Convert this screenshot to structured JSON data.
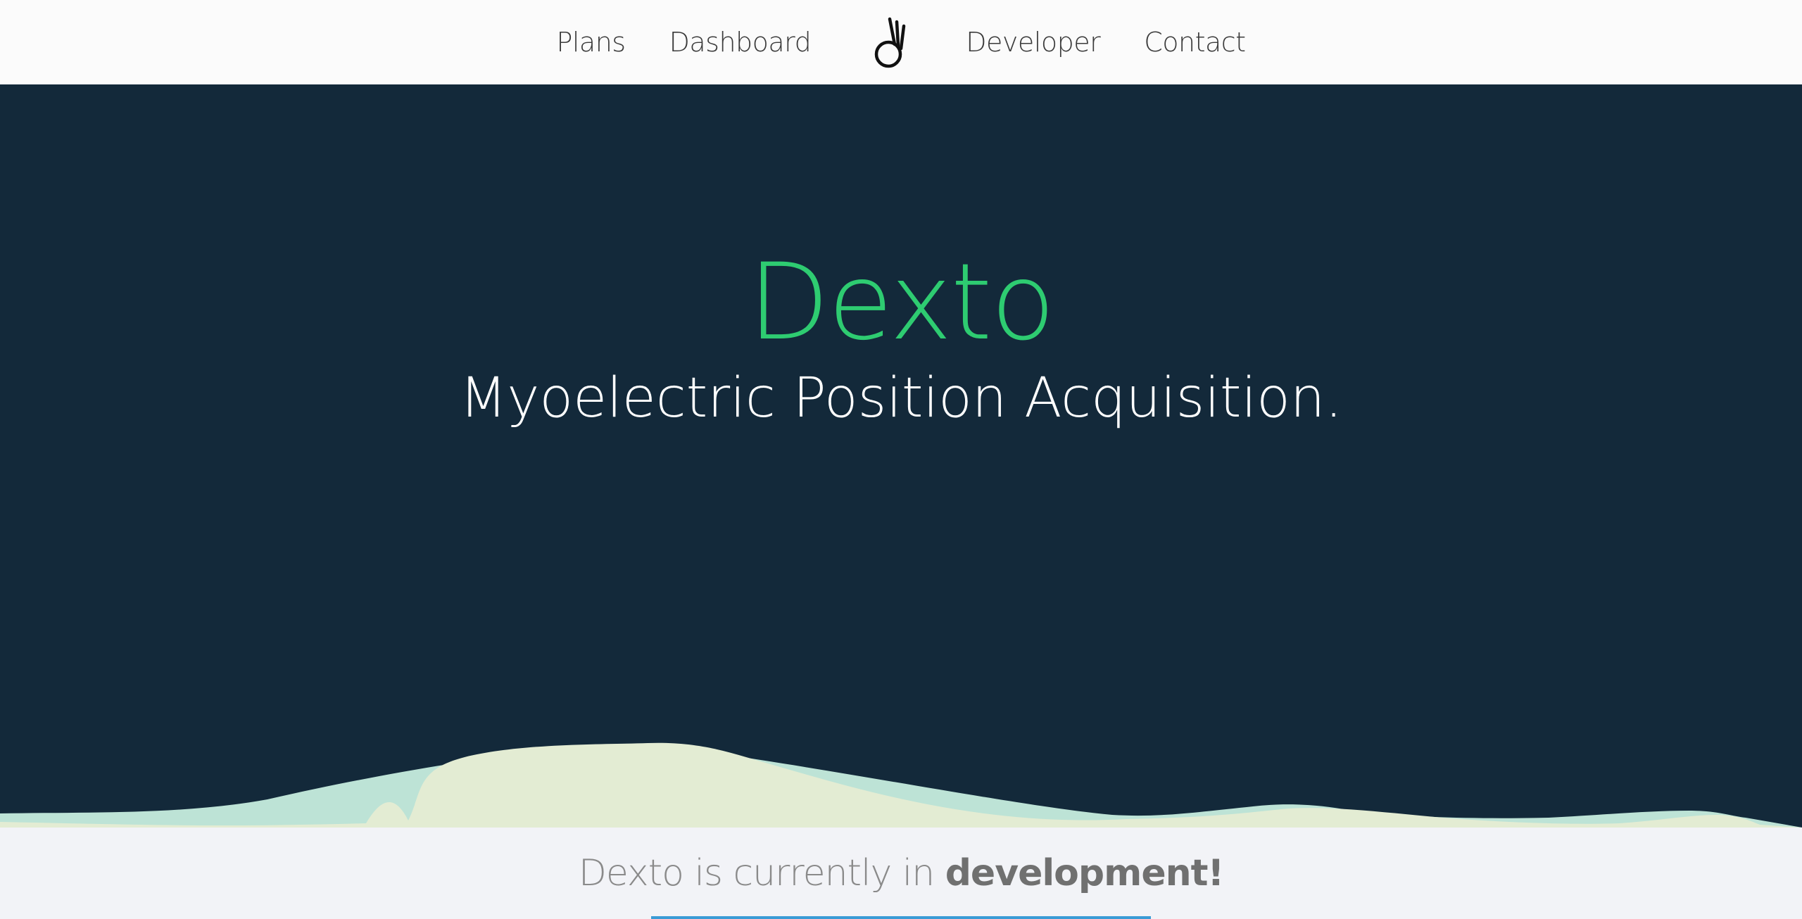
{
  "nav": {
    "left_links": [
      "Plans",
      "Dashboard"
    ],
    "right_links": [
      "Developer",
      "Contact"
    ],
    "logo_icon": "ok-hand-icon"
  },
  "hero": {
    "title": "Dexto",
    "subtitle": "Myoelectric Position Acquisition.",
    "title_color": "#2ecc71",
    "background_color": "#13293a"
  },
  "banner": {
    "text_prefix": "Dexto is currently in ",
    "text_emphasis": "development!"
  },
  "colors": {
    "nav_bg": "#fbfbfb",
    "hill_light": "#e3ecd3",
    "hill_mint": "#bde3d6",
    "accent_bar": "#3a9bd6"
  }
}
